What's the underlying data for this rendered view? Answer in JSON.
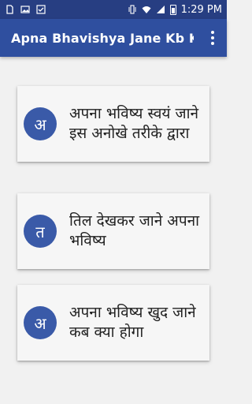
{
  "status_bar": {
    "time": "1:29 PM",
    "icons": [
      "sim-card-icon",
      "image-icon",
      "checkbox-icon",
      "vibrate-icon",
      "wifi-icon",
      "signal-icon",
      "battery-icon"
    ]
  },
  "app_bar": {
    "title": "Apna Bhavishya Jane Kb K...",
    "menu_icon": "more-vert-icon"
  },
  "colors": {
    "status_bar": "#273e82",
    "app_bar": "#2f4f9f",
    "avatar": "#3a5aa8",
    "background": "#f1f1f1",
    "card": "#f6f6f6"
  },
  "cards": [
    {
      "letter": "अ",
      "text": "अपना भविष्य स्वयं जाने इस अनोखे तरीके द्वारा"
    },
    {
      "letter": "त",
      "text": "तिल देखकर जाने अपना भविष्य"
    },
    {
      "letter": "अ",
      "text": "अपना भविष्य खुद जाने कब क्या होगा"
    }
  ]
}
